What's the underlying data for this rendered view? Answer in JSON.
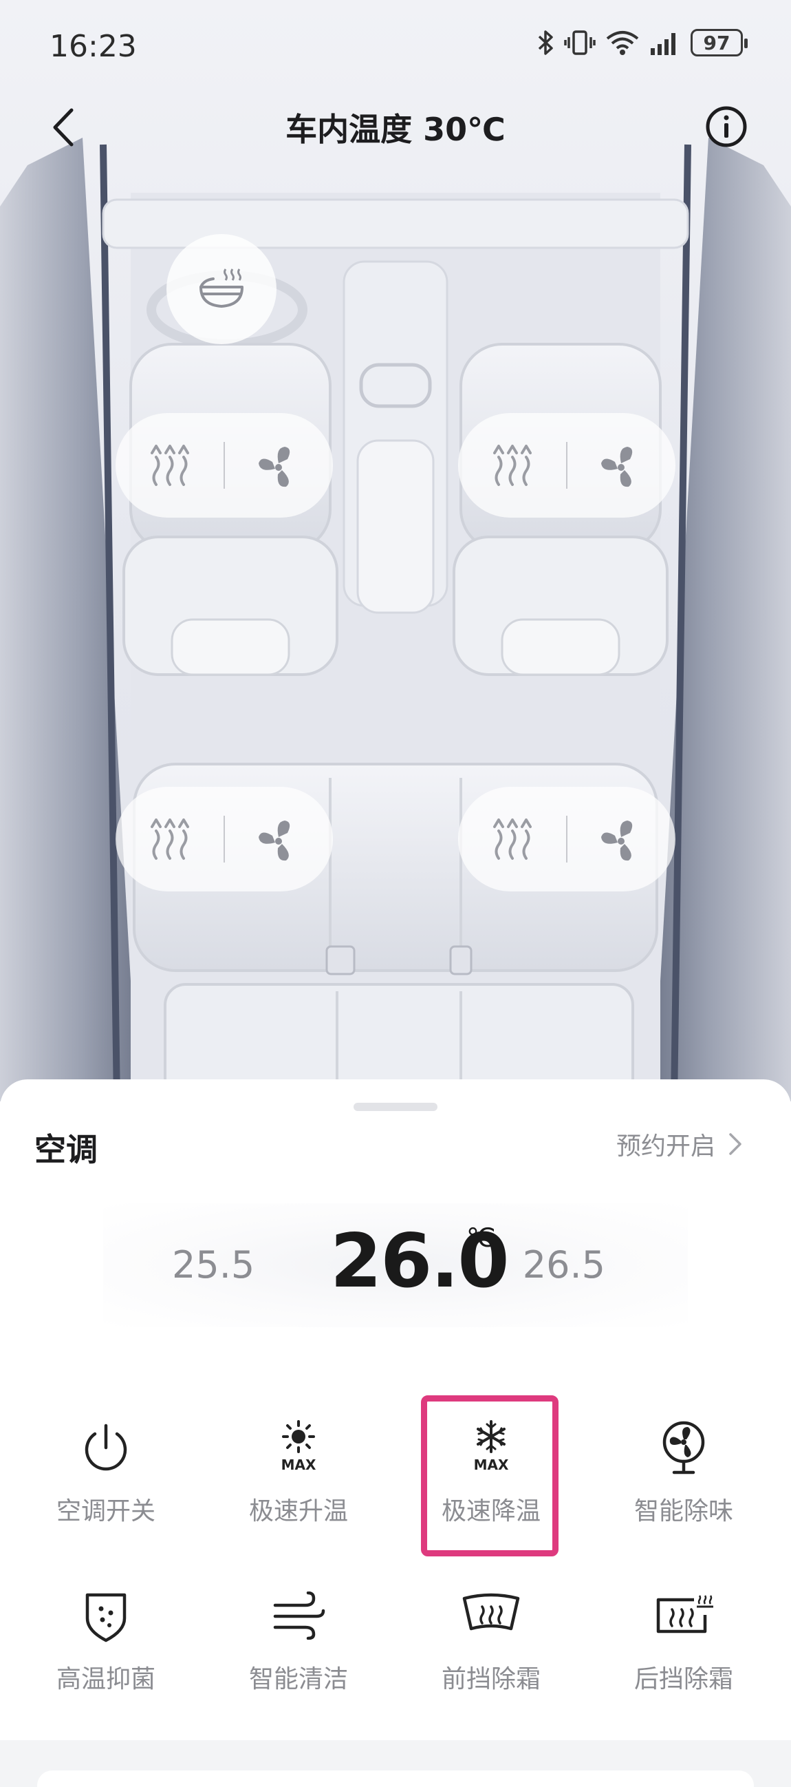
{
  "status_bar": {
    "time": "16:23",
    "battery": "97"
  },
  "header": {
    "title": "车内温度 30℃"
  },
  "climate": {
    "section_title": "空调",
    "schedule_label": "预约开启",
    "temp_prev": "25.5",
    "temp_current": "26.0",
    "temp_unit": "℃",
    "temp_next": "26.5",
    "functions": [
      {
        "label": "空调开关",
        "icon": "power-icon"
      },
      {
        "label": "极速升温",
        "icon": "sun-max-icon"
      },
      {
        "label": "极速降温",
        "icon": "snowflake-max-icon",
        "highlighted": true
      },
      {
        "label": "智能除味",
        "icon": "fan-icon"
      },
      {
        "label": "高温抑菌",
        "icon": "shield-icon"
      },
      {
        "label": "智能清洁",
        "icon": "wind-icon"
      },
      {
        "label": "前挡除霜",
        "icon": "front-defrost-icon"
      },
      {
        "label": "后挡除霜",
        "icon": "rear-defrost-icon"
      }
    ],
    "max_text": "MAX"
  },
  "colors": {
    "highlight": "#de3a7e",
    "label_gray": "#8b8c91",
    "icon_dark": "#222222"
  }
}
